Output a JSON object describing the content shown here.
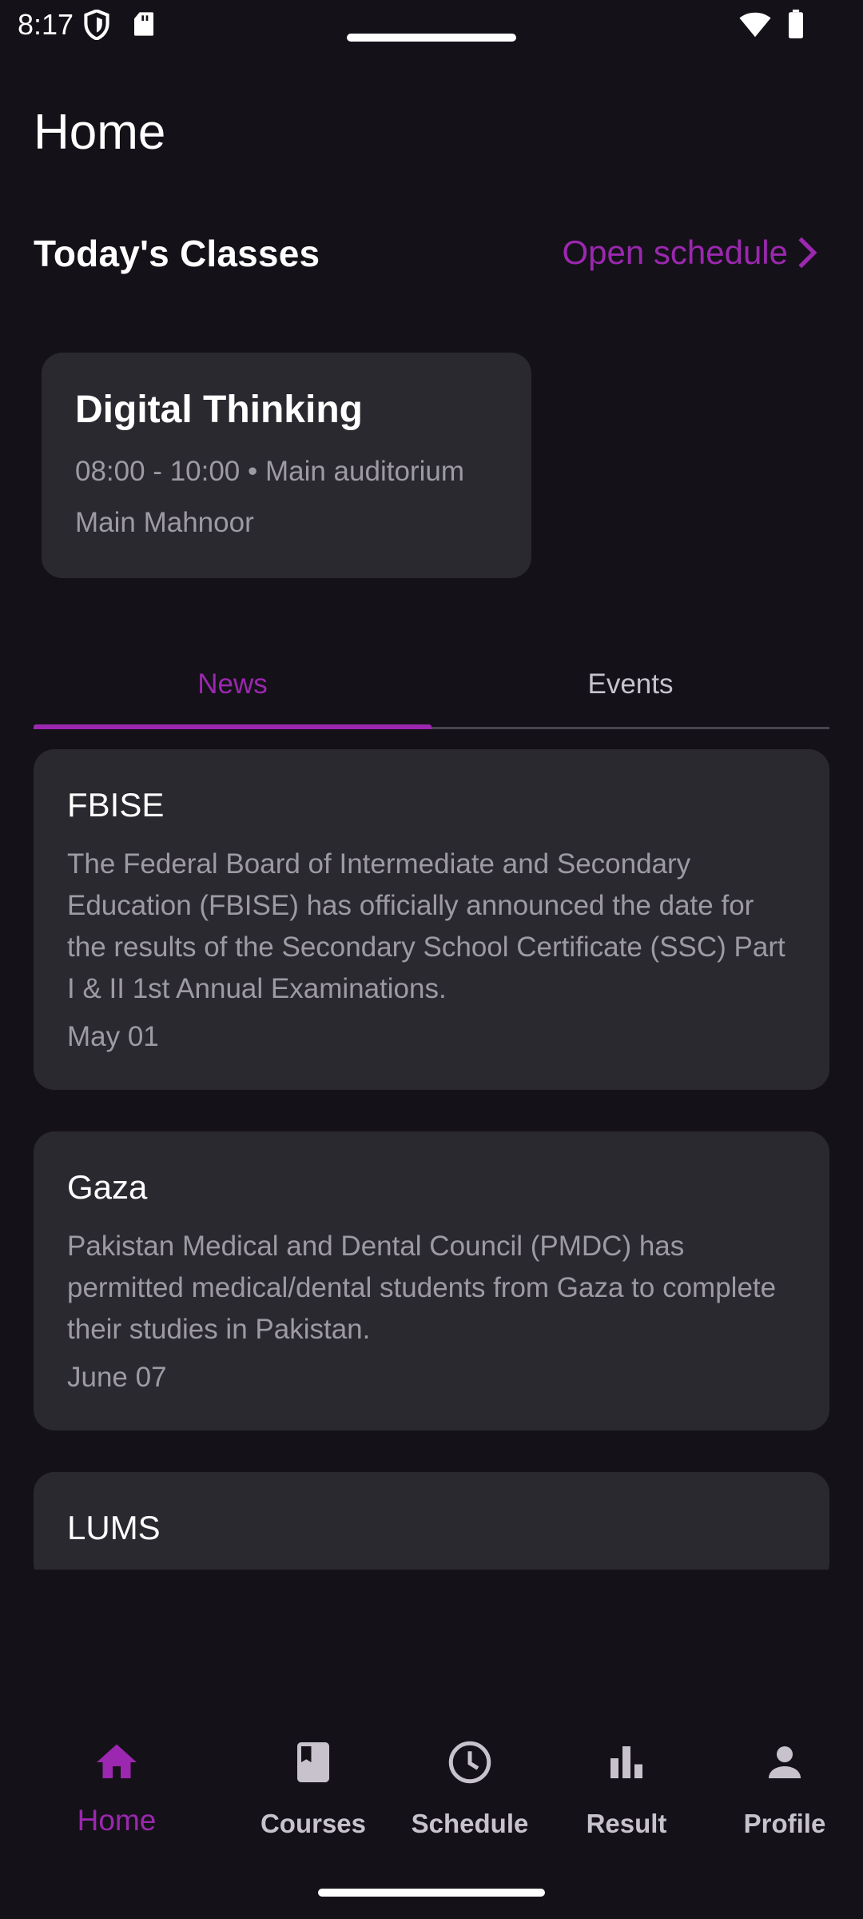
{
  "status_bar": {
    "time": "8:17",
    "icons": [
      "shield-icon",
      "sd-card-icon",
      "wifi-icon",
      "battery-icon"
    ]
  },
  "page": {
    "title": "Home"
  },
  "todays_classes": {
    "title": "Today's Classes",
    "open_schedule_label": "Open schedule",
    "classes": [
      {
        "name": "Digital Thinking",
        "time_location": "08:00 - 10:00 • Main auditorium",
        "teacher": "Main Mahnoor"
      }
    ]
  },
  "tabs": [
    {
      "label": "News",
      "active": true
    },
    {
      "label": "Events",
      "active": false
    }
  ],
  "news": [
    {
      "title": "FBISE",
      "body": "The Federal Board of Intermediate and Secondary Education (FBISE) has officially announced the date for the results of the Secondary School Certificate (SSC) Part I & II 1st Annual Examinations.",
      "date": "May 01"
    },
    {
      "title": "Gaza",
      "body": "Pakistan Medical and Dental Council (PMDC) has permitted medical/dental students from Gaza to complete their studies in Pakistan.",
      "date": "June 07"
    },
    {
      "title": "LUMS",
      "body": "",
      "date": ""
    }
  ],
  "bottom_nav": [
    {
      "label": "Home",
      "icon": "home-icon",
      "active": true
    },
    {
      "label": "Courses",
      "icon": "book-icon",
      "active": false
    },
    {
      "label": "Schedule",
      "icon": "clock-icon",
      "active": false
    },
    {
      "label": "Result",
      "icon": "bar-chart-icon",
      "active": false
    },
    {
      "label": "Profile",
      "icon": "person-icon",
      "active": false
    }
  ],
  "colors": {
    "background": "#141218",
    "surface": "#2B2930",
    "accent": "#9C27B0",
    "text_primary": "#FFFFFF",
    "text_secondary": "#9E9AA3"
  }
}
